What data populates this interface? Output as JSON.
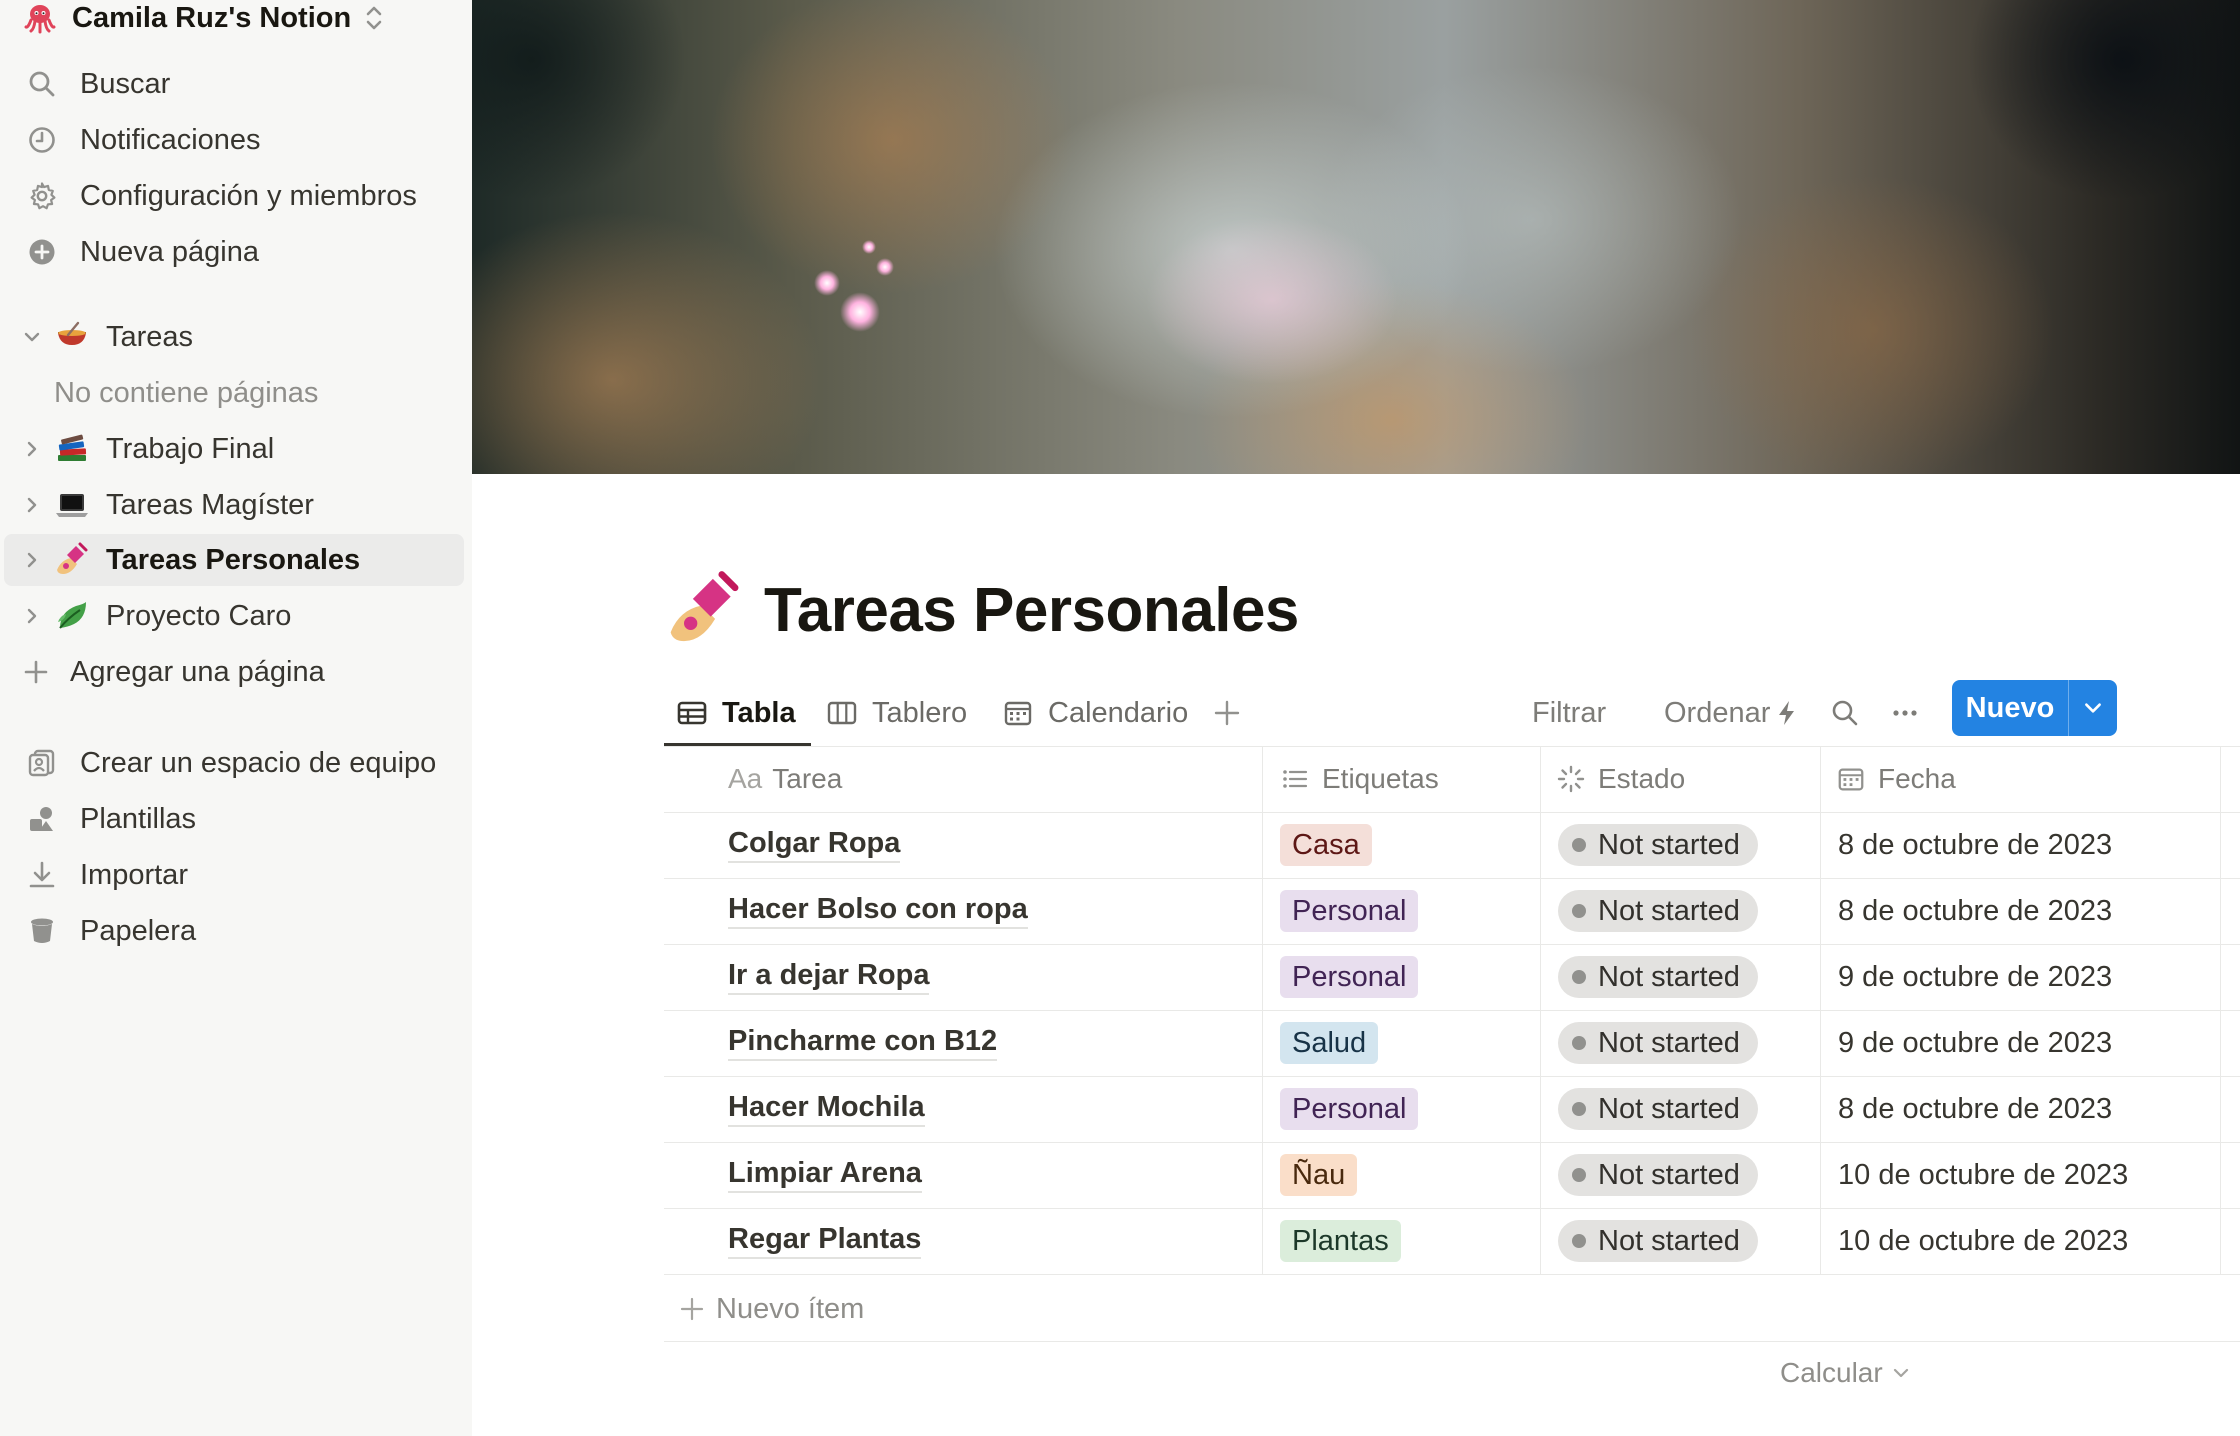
{
  "sidebar": {
    "workspace_name": "Camila Ruz's Notion",
    "workspace_icon": "octopus-icon",
    "top_items": [
      {
        "label": "Buscar",
        "icon": "search-icon"
      },
      {
        "label": "Notificaciones",
        "icon": "clock-icon"
      },
      {
        "label": "Configuración y miembros",
        "icon": "gear-icon"
      },
      {
        "label": "Nueva página",
        "icon": "plus-circle-icon"
      }
    ],
    "pages": [
      {
        "label": "Tareas",
        "icon": "bowl-icon",
        "expanded": true
      },
      {
        "label": "Trabajo Final",
        "icon": "books-icon"
      },
      {
        "label": "Tareas Magíster",
        "icon": "laptop-icon"
      },
      {
        "label": "Tareas Personales",
        "icon": "nail-polish-icon",
        "selected": true
      },
      {
        "label": "Proyecto Caro",
        "icon": "leaf-icon"
      }
    ],
    "no_pages_text": "No contiene páginas",
    "add_page": "Agregar una página",
    "bottom_items": [
      {
        "label": "Crear un espacio de equipo",
        "icon": "teamspace-icon"
      },
      {
        "label": "Plantillas",
        "icon": "templates-icon"
      },
      {
        "label": "Importar",
        "icon": "download-icon"
      },
      {
        "label": "Papelera",
        "icon": "trash-icon"
      }
    ]
  },
  "page": {
    "title": "Tareas Personales",
    "icon": "nail-polish-icon",
    "cover": "nebula-cover"
  },
  "views": {
    "tabs": [
      {
        "label": "Tabla",
        "icon": "table-icon",
        "active": true
      },
      {
        "label": "Tablero",
        "icon": "board-icon"
      },
      {
        "label": "Calendario",
        "icon": "calendar-icon"
      }
    ],
    "filter": "Filtrar",
    "sort": "Ordenar",
    "new_button": "Nuevo"
  },
  "table": {
    "columns": [
      {
        "label": "Tarea",
        "prefix": "Aa"
      },
      {
        "label": "Etiquetas",
        "icon": "list-icon"
      },
      {
        "label": "Estado",
        "icon": "loading-icon"
      },
      {
        "label": "Fecha",
        "icon": "calendar-icon"
      }
    ],
    "rows": [
      {
        "task": "Colgar Ropa",
        "tag": "Casa",
        "tag_color": "#fdebec",
        "tag_text": "#5d1715",
        "tag_bg": "#f4dfd9",
        "status": "Not started",
        "date": "8 de octubre de 2023"
      },
      {
        "task": "Hacer Bolso con ropa",
        "tag": "Personal",
        "tag_bg": "#e8deee",
        "tag_text": "#412454",
        "status": "Not started",
        "date": "8 de octubre de 2023"
      },
      {
        "task": "Ir a dejar Ropa",
        "tag": "Personal",
        "tag_bg": "#e8deee",
        "tag_text": "#412454",
        "status": "Not started",
        "date": "9 de octubre de 2023"
      },
      {
        "task": "Pincharme con B12",
        "tag": "Salud",
        "tag_bg": "#d3e5ef",
        "tag_text": "#183347",
        "status": "Not started",
        "date": "9 de octubre de 2023"
      },
      {
        "task": "Hacer Mochila",
        "tag": "Personal",
        "tag_bg": "#e8deee",
        "tag_text": "#412454",
        "status": "Not started",
        "date": "8 de octubre de 2023"
      },
      {
        "task": "Limpiar Arena",
        "tag": "Ñau",
        "tag_bg": "#fadec9",
        "tag_text": "#49290e",
        "status": "Not started",
        "date": "10 de octubre de 2023"
      },
      {
        "task": "Regar Plantas",
        "tag": "Plantas",
        "tag_bg": "#dbeddb",
        "tag_text": "#1c3829",
        "status": "Not started",
        "date": "10 de octubre de 2023"
      }
    ],
    "new_item": "Nuevo ítem",
    "calculate": "Calcular"
  }
}
